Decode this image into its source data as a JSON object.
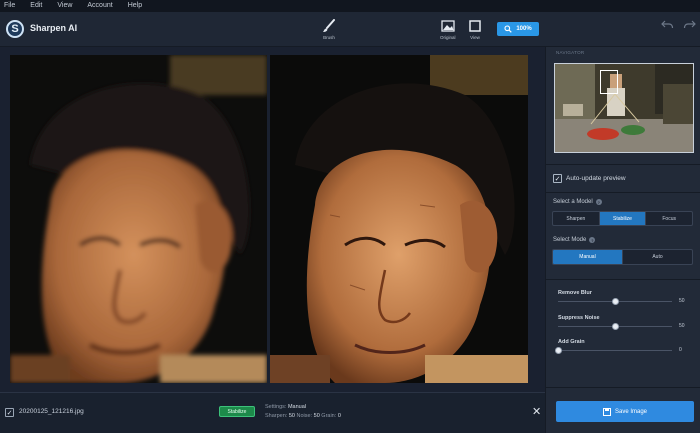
{
  "menu": [
    "File",
    "Edit",
    "View",
    "Account",
    "Help"
  ],
  "app": {
    "name": "Sharpen AI",
    "logo_letter": "S"
  },
  "toolbar": {
    "brush_label": "Brush",
    "original_label": "Original",
    "view_label": "View",
    "zoom_label": "100%"
  },
  "navigator": {
    "label": "NAVIGATOR"
  },
  "auto_update": {
    "label": "Auto-update preview",
    "checked": true
  },
  "model": {
    "title": "Select a Model",
    "options": [
      "Sharpen",
      "Stabilize",
      "Focus"
    ],
    "selected": "Stabilize"
  },
  "mode": {
    "title": "Select Mode",
    "options": [
      "Manual",
      "Auto"
    ],
    "selected": "Manual"
  },
  "sliders": [
    {
      "label": "Remove Blur",
      "value": 50,
      "fraction": 0.5
    },
    {
      "label": "Suppress Noise",
      "value": 50,
      "fraction": 0.5
    },
    {
      "label": "Add Grain",
      "value": 0,
      "fraction": 0.0
    }
  ],
  "save_button": "Save Image",
  "file": {
    "name": "20200125_121216.jpg",
    "badge": "Stabilize",
    "settings_label": "Settings:",
    "settings_value": "Manual",
    "sharpen_label": "Sharpen:",
    "sharpen_value": "50",
    "noise_label": "Noise:",
    "noise_value": "50",
    "grain_label": "Grain:",
    "grain_value": "0"
  },
  "colors": {
    "accent": "#2a97e6",
    "active_segment": "#2377c0",
    "badge_green": "#1d8a4a"
  }
}
